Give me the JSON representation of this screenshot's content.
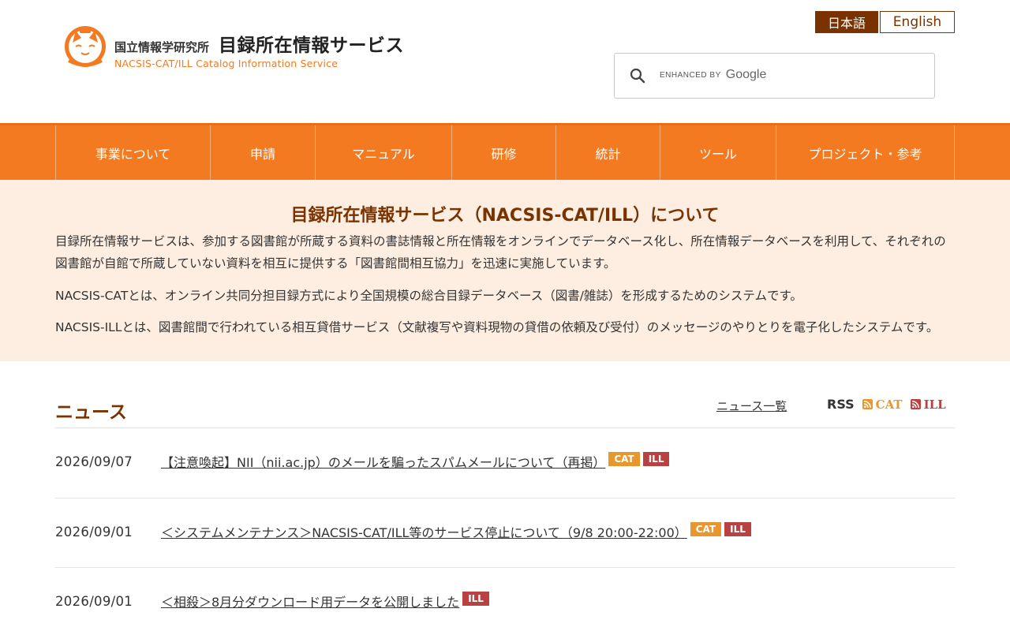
{
  "header": {
    "org_name": "国立情報学研究所",
    "service_name": "目録所在情報サービス",
    "service_name_en": "NACSIS-CAT/ILL Catalog Information Service",
    "lang_ja": "日本語",
    "lang_en": "English"
  },
  "search": {
    "placeholder_small": "ENHANCED BY",
    "placeholder_brand": "Google",
    "value": ""
  },
  "nav": {
    "items": [
      {
        "label": "事業について"
      },
      {
        "label": "申請"
      },
      {
        "label": "マニュアル"
      },
      {
        "label": "研修"
      },
      {
        "label": "統計"
      },
      {
        "label": "ツール"
      },
      {
        "label": "プロジェクト・参考"
      }
    ]
  },
  "about": {
    "title": "目録所在情報サービス（NACSIS-CAT/ILL）について",
    "p1": "目録所在情報サービスは、参加する図書館が所蔵する資料の書誌情報と所在情報をオンラインでデータベース化し、所在情報データベースを利用して、それぞれの図書館が自館で所蔵していない資料を相互に提供する「図書館間相互協力」を迅速に実施しています。",
    "p2": "NACSIS-CATとは、オンライン共同分担目録方式により全国規模の総合目録データベース（図書/雑誌）を形成するためのシステムです。",
    "p3": "NACSIS-ILLとは、図書館間で行われている相互貸借サービス（文献複写や資料現物の貸借の依頼及び受付）のメッセージのやりとりを電子化したシステムです。"
  },
  "news": {
    "title": "ニュース",
    "all_link": "ニュース一覧",
    "rss_label": "RSS",
    "rss_cat": "CAT",
    "rss_ill": "ILL",
    "items": [
      {
        "date": "2026/09/07",
        "title": "【注意喚起】NII（nii.ac.jp）のメールを騙ったスパムメールについて（再掲）",
        "tags": [
          "CAT",
          "ILL"
        ]
      },
      {
        "date": "2026/09/01",
        "title": "＜システムメンテナンス＞NACSIS-CAT/ILL等のサービス停止について（9/8 20:00-22:00）",
        "tags": [
          "CAT",
          "ILL"
        ]
      },
      {
        "date": "2026/09/01",
        "title": "＜相殺＞8月分ダウンロード用データを公開しました",
        "tags": [
          "ILL"
        ]
      }
    ]
  },
  "colors": {
    "brand_orange": "#f47a21",
    "brand_brown": "#7a3300",
    "about_bg": "#fdeee1",
    "tag_cat": "#e8962e",
    "tag_ill": "#b94141"
  }
}
